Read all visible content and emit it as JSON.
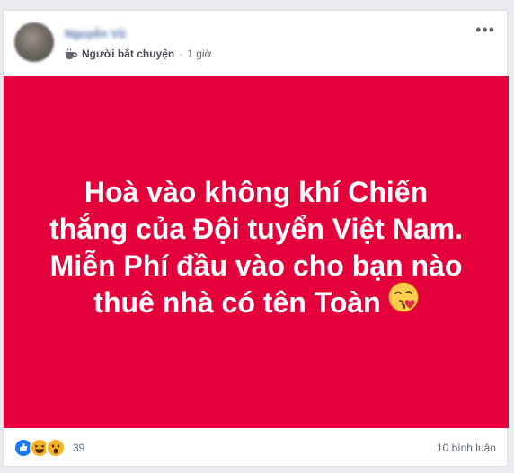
{
  "post": {
    "author": "Nguyễn Vũ",
    "badge_label": "Người bắt chuyện",
    "separator": "·",
    "time": "1 giờ",
    "more_label": "•••",
    "lines": [
      "Hoà vào không khí Chiến",
      "thắng của Đội tuyển Việt Nam.",
      "Miễn Phí đầu vào cho bạn nào",
      "thuê nhà có tên Toàn"
    ],
    "colors": {
      "background": "#e4003a",
      "text": "#ffffff"
    }
  },
  "footer": {
    "reaction_icons": [
      "like-icon",
      "haha-icon",
      "wow-icon"
    ],
    "reaction_count": "39",
    "comments_label": "10 bình luận"
  }
}
